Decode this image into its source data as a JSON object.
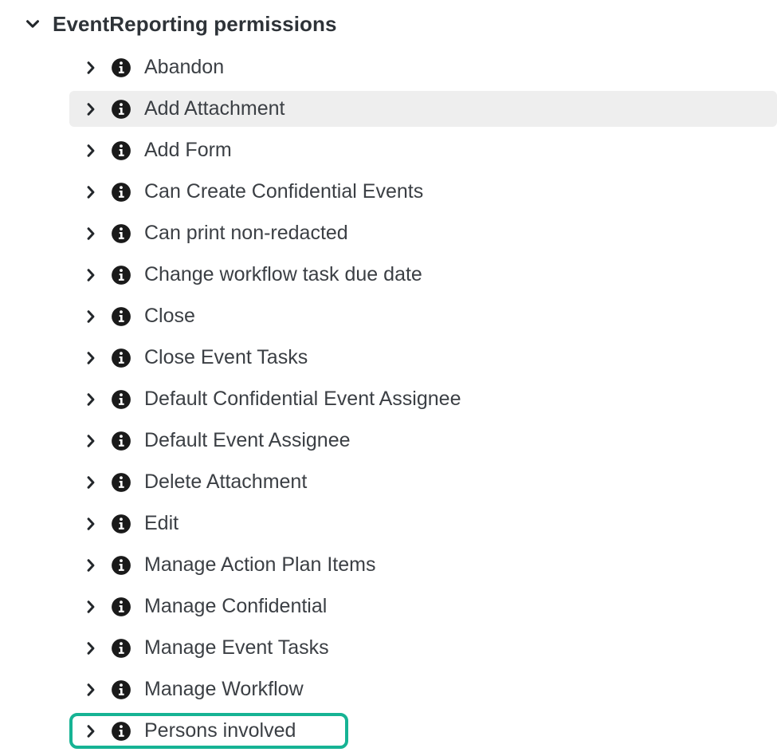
{
  "group": {
    "title": "EventReporting permissions",
    "expanded": true,
    "caret_icon": "chevron-down-icon"
  },
  "row_icons": {
    "expander": "chevron-right-icon",
    "info": "info-circle-icon"
  },
  "colors": {
    "highlight_box_border": "#16b394",
    "hover_row_background": "#eeeeee",
    "label_text": "#3b3f44",
    "title_text": "#2e3338",
    "info_icon_fill": "#1a1a1a",
    "page_background": "#ffffff"
  },
  "permissions": [
    {
      "label": "Abandon",
      "state": "normal"
    },
    {
      "label": "Add Attachment",
      "state": "hovered"
    },
    {
      "label": "Add Form",
      "state": "normal"
    },
    {
      "label": "Can Create Confidential Events",
      "state": "normal"
    },
    {
      "label": "Can print non-redacted",
      "state": "normal"
    },
    {
      "label": "Change workflow task due date",
      "state": "normal"
    },
    {
      "label": "Close",
      "state": "normal"
    },
    {
      "label": "Close Event Tasks",
      "state": "normal"
    },
    {
      "label": "Default Confidential Event Assignee",
      "state": "normal"
    },
    {
      "label": "Default Event Assignee",
      "state": "normal"
    },
    {
      "label": "Delete Attachment",
      "state": "normal"
    },
    {
      "label": "Edit",
      "state": "normal"
    },
    {
      "label": "Manage Action Plan Items",
      "state": "normal"
    },
    {
      "label": "Manage Confidential",
      "state": "normal"
    },
    {
      "label": "Manage Event Tasks",
      "state": "normal"
    },
    {
      "label": "Manage Workflow",
      "state": "normal"
    },
    {
      "label": "Persons involved",
      "state": "boxed"
    }
  ]
}
